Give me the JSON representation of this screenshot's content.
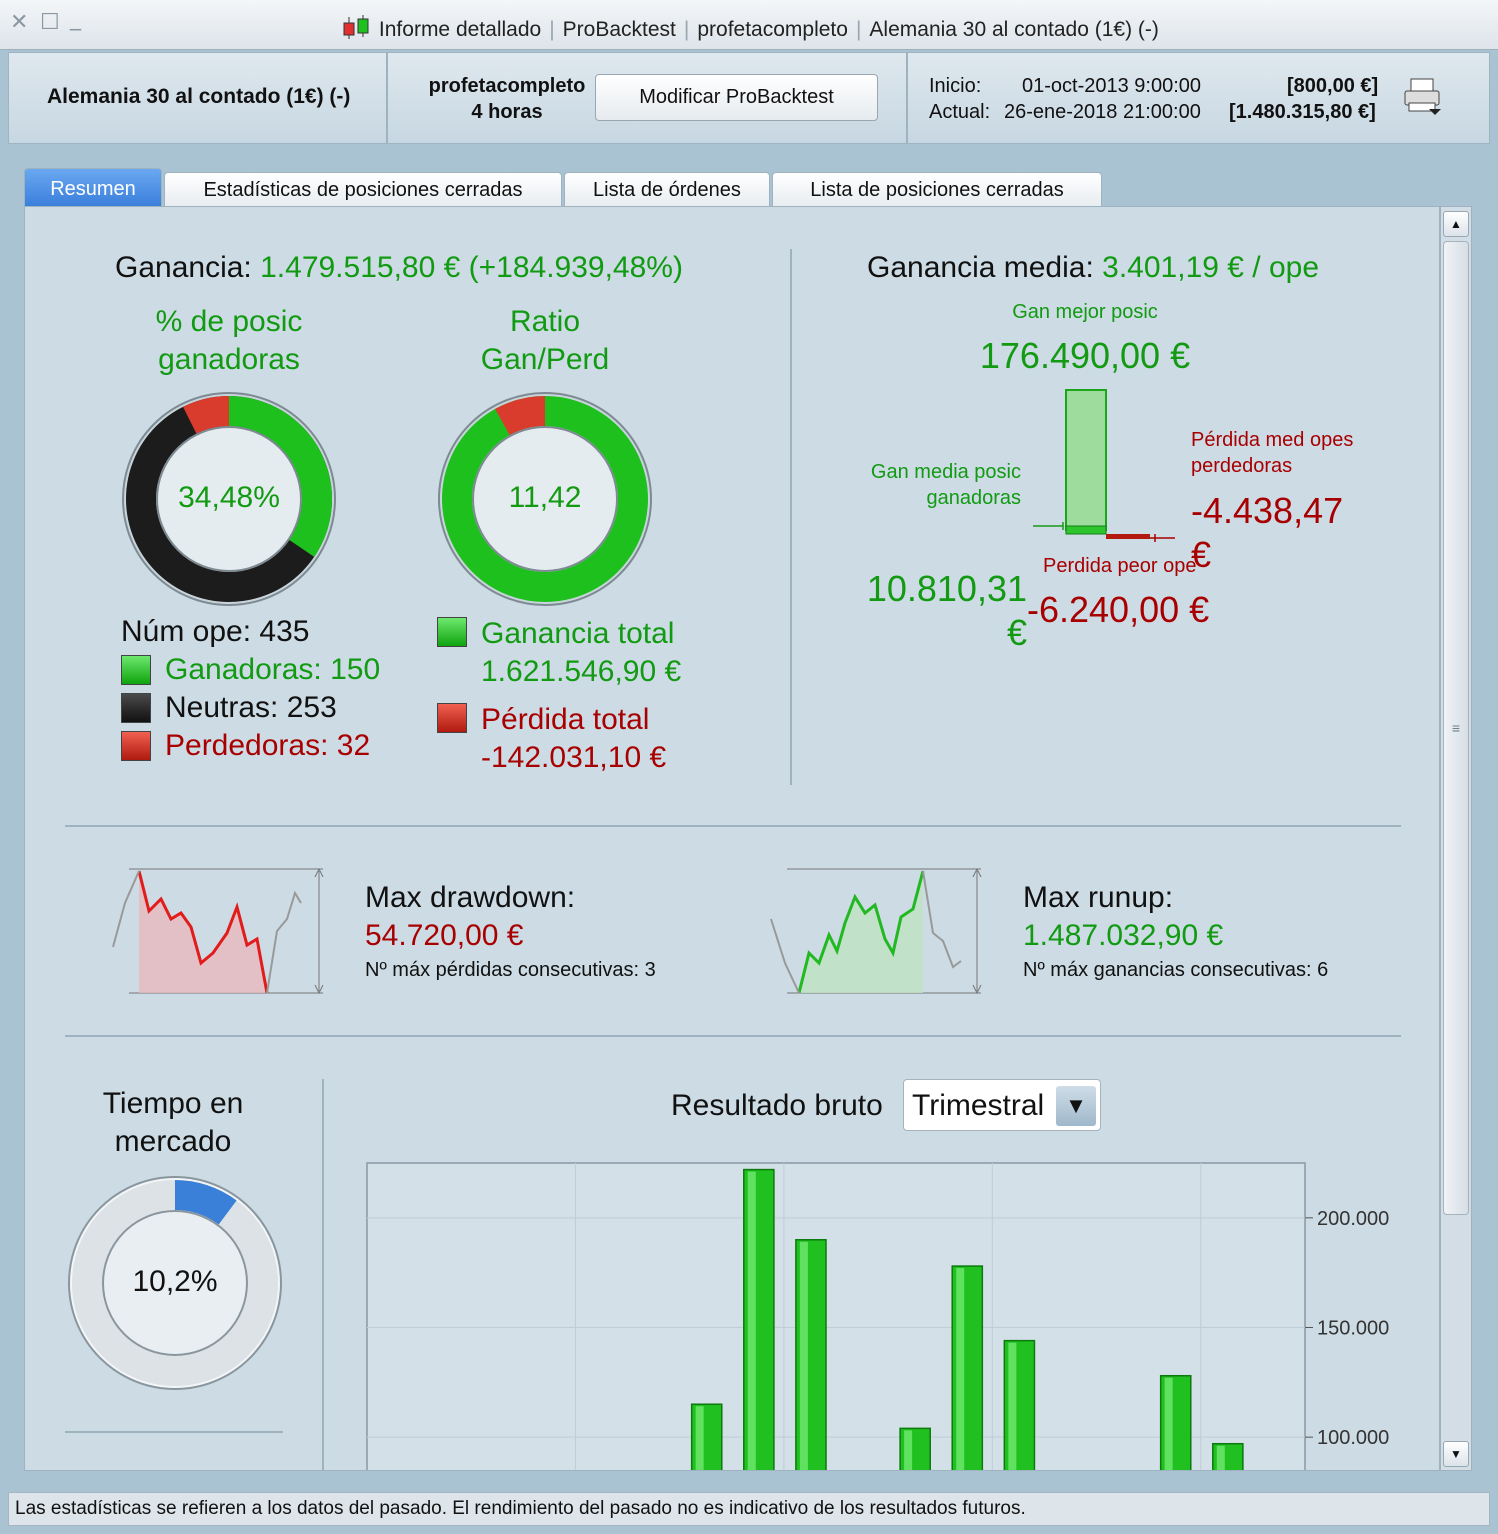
{
  "window": {
    "close": "✕",
    "maximize": "☐",
    "minimize": "_",
    "title_parts": [
      "Informe detallado",
      "ProBacktest",
      "profetacompleto",
      "Alemania 30 al contado (1€) (-)"
    ]
  },
  "header": {
    "instrument": "Alemania 30 al contado (1€) (-)",
    "strategy_name": "profetacompleto",
    "timeframe": "4 horas",
    "modify_button": "Modificar ProBacktest",
    "start_label": "Inicio:",
    "start_date": "01-oct-2013 9:00:00",
    "start_value": "[800,00 €]",
    "current_label": "Actual:",
    "current_date": "26-ene-2018 21:00:00",
    "current_value": "[1.480.315,80 €]"
  },
  "tabs": [
    {
      "label": "Resumen",
      "active": true
    },
    {
      "label": "Estadísticas de posiciones cerradas",
      "active": false
    },
    {
      "label": "Lista de órdenes",
      "active": false
    },
    {
      "label": "Lista de posiciones cerradas",
      "active": false
    }
  ],
  "summary": {
    "gain_label": "Ganancia:",
    "gain_value": "1.479.515,80 € (+184.939,48%)",
    "winners_title_1": "% de posic",
    "winners_title_2": "ganadoras",
    "winners_pct": "34,48%",
    "winners_pct_value": 0.3448,
    "losers_pct_value": 0.0736,
    "ratio_title_1": "Ratio",
    "ratio_title_2": "Gan/Perd",
    "ratio_value": "11,42",
    "ratio_loss_fraction": 0.0805,
    "num_ops": "Núm ope: 435",
    "winners": "Ganadoras: 150",
    "neutrals": "Neutras: 253",
    "losers": "Perdedoras: 32",
    "total_gain_label": "Ganancia total",
    "total_gain_value": "1.621.546,90 €",
    "total_loss_label": "Pérdida total",
    "total_loss_value": "-142.031,10 €",
    "avg_gain_label": "Ganancia media:",
    "avg_gain_value": "3.401,19 € / ope",
    "best_label": "Gan mejor posic",
    "best_value": "176.490,00 €",
    "avg_win_label_1": "Gan media posic",
    "avg_win_label_2": "ganadoras",
    "avg_win_value_1": "10.810,31",
    "avg_win_value_2": "€",
    "avg_loss_label_1": "Pérdida med opes",
    "avg_loss_label_2": "perdedoras",
    "avg_loss_value_1": "-4.438,47",
    "avg_loss_value_2": "€",
    "worst_label": "Perdida peor ope",
    "worst_value": "-6.240,00 €"
  },
  "drawdown": {
    "title": "Max drawdown:",
    "value": "54.720,00 €",
    "consecutive": "Nº máx pérdidas consecutivas: 3"
  },
  "runup": {
    "title": "Max runup:",
    "value": "1.487.032,90 €",
    "consecutive": "Nº máx ganancias consecutivas: 6"
  },
  "market_time": {
    "title_1": "Tiempo en",
    "title_2": "mercado",
    "value": "10,2%",
    "fraction": 0.102
  },
  "gross_result": {
    "label": "Resultado bruto",
    "period": "Trimestral"
  },
  "chart_data": {
    "type": "bar",
    "title": "",
    "ylim": [
      80000,
      225000
    ],
    "yticks": [
      100000,
      150000,
      200000
    ],
    "ytick_labels": [
      "100.000",
      "150.000",
      "200.000"
    ],
    "slots": 18,
    "bars": [
      {
        "slot": 6,
        "value": 115000
      },
      {
        "slot": 7,
        "value": 222000
      },
      {
        "slot": 8,
        "value": 190000
      },
      {
        "slot": 10,
        "value": 104000
      },
      {
        "slot": 11,
        "value": 178000
      },
      {
        "slot": 12,
        "value": 144000
      },
      {
        "slot": 15,
        "value": 128000
      },
      {
        "slot": 16,
        "value": 97000
      }
    ],
    "color": "#1fc01f"
  },
  "status": "Las estadísticas se refieren a los datos del pasado. El rendimiento del pasado no es indicativo de los resultados futuros."
}
